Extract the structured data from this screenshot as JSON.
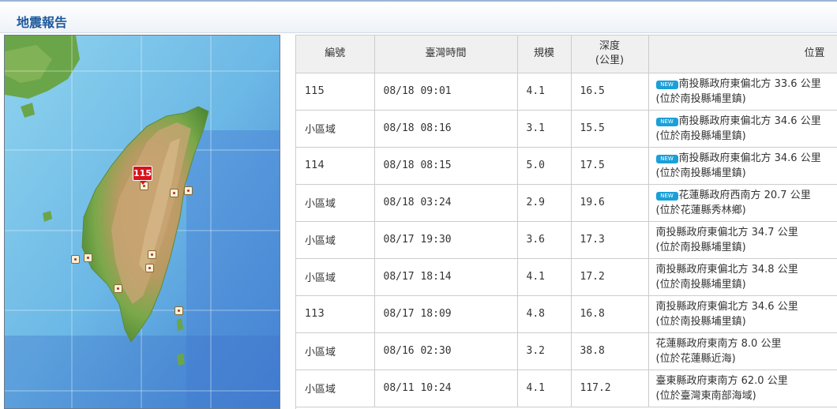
{
  "header": {
    "title": "地震報告"
  },
  "map": {
    "latest_label": "115"
  },
  "table": {
    "columns": {
      "id": "編號",
      "time": "臺灣時間",
      "magnitude": "規模",
      "depth_line1": "深度",
      "depth_line2": "(公里)",
      "location": "位置"
    },
    "new_badge": "NEW",
    "rows": [
      {
        "id": "115",
        "time": "08/18 09:01",
        "magnitude": "4.1",
        "depth": "16.5",
        "is_new": true,
        "loc1": "南投縣政府東偏北方 33.6 公里",
        "loc2": "(位於南投縣埔里鎮)"
      },
      {
        "id": "小區域",
        "time": "08/18 08:16",
        "magnitude": "3.1",
        "depth": "15.5",
        "is_new": true,
        "loc1": "南投縣政府東偏北方 34.6 公里",
        "loc2": "(位於南投縣埔里鎮)"
      },
      {
        "id": "114",
        "time": "08/18 08:15",
        "magnitude": "5.0",
        "depth": "17.5",
        "is_new": true,
        "loc1": "南投縣政府東偏北方 34.6 公里",
        "loc2": "(位於南投縣埔里鎮)"
      },
      {
        "id": "小區域",
        "time": "08/18 03:24",
        "magnitude": "2.9",
        "depth": "19.6",
        "is_new": true,
        "loc1": "花蓮縣政府西南方 20.7 公里",
        "loc2": "(位於花蓮縣秀林鄉)"
      },
      {
        "id": "小區域",
        "time": "08/17 19:30",
        "magnitude": "3.6",
        "depth": "17.3",
        "is_new": false,
        "loc1": "南投縣政府東偏北方 34.7 公里",
        "loc2": "(位於南投縣埔里鎮)"
      },
      {
        "id": "小區域",
        "time": "08/17 18:14",
        "magnitude": "4.1",
        "depth": "17.2",
        "is_new": false,
        "loc1": "南投縣政府東偏北方 34.8 公里",
        "loc2": "(位於南投縣埔里鎮)"
      },
      {
        "id": "113",
        "time": "08/17 18:09",
        "magnitude": "4.8",
        "depth": "16.8",
        "is_new": false,
        "loc1": "南投縣政府東偏北方 34.6 公里",
        "loc2": "(位於南投縣埔里鎮)"
      },
      {
        "id": "小區域",
        "time": "08/16 02:30",
        "magnitude": "3.2",
        "depth": "38.8",
        "is_new": false,
        "loc1": "花蓮縣政府東南方 8.0 公里",
        "loc2": "(位於花蓮縣近海)"
      },
      {
        "id": "小區域",
        "time": "08/11 10:24",
        "magnitude": "4.1",
        "depth": "117.2",
        "is_new": false,
        "loc1": "臺東縣政府東南方 62.0 公里",
        "loc2": "(位於臺灣東南部海域)"
      }
    ]
  }
}
